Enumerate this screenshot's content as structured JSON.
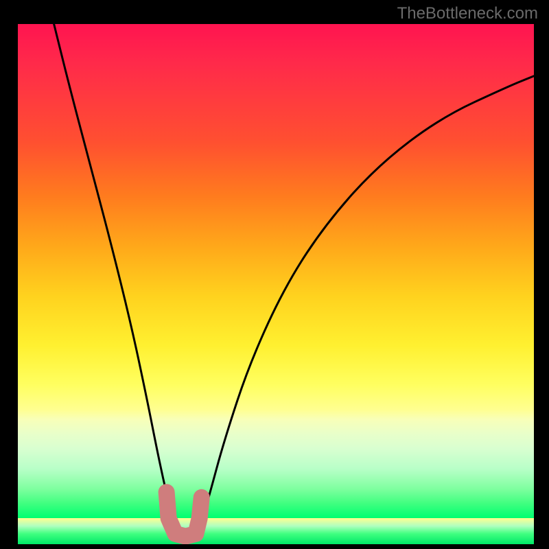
{
  "watermark": "TheBottleneck.com",
  "chart_data": {
    "type": "line",
    "title": "",
    "xlabel": "",
    "ylabel": "",
    "xlim": [
      0,
      100
    ],
    "ylim": [
      0,
      100
    ],
    "series": [
      {
        "name": "curve",
        "x": [
          7,
          10,
          14,
          18,
          22,
          25,
          27,
          28.5,
          30,
          32,
          34,
          35.5,
          37,
          40,
          45,
          52,
          60,
          70,
          82,
          95,
          100
        ],
        "values": [
          100,
          88,
          73,
          58,
          42,
          28,
          18,
          11,
          5,
          2,
          2,
          4,
          9,
          20,
          35,
          50,
          62,
          73,
          82,
          88,
          90
        ]
      }
    ],
    "annotations": [
      {
        "name": "flat-bottom-marker",
        "type": "path-marker",
        "color": "#d08080",
        "points_x": [
          28.8,
          29.2,
          30.5,
          32.5,
          34.5,
          35.2,
          35.6
        ],
        "points_y": [
          10,
          5,
          2,
          1.5,
          2,
          5,
          9
        ]
      }
    ]
  }
}
